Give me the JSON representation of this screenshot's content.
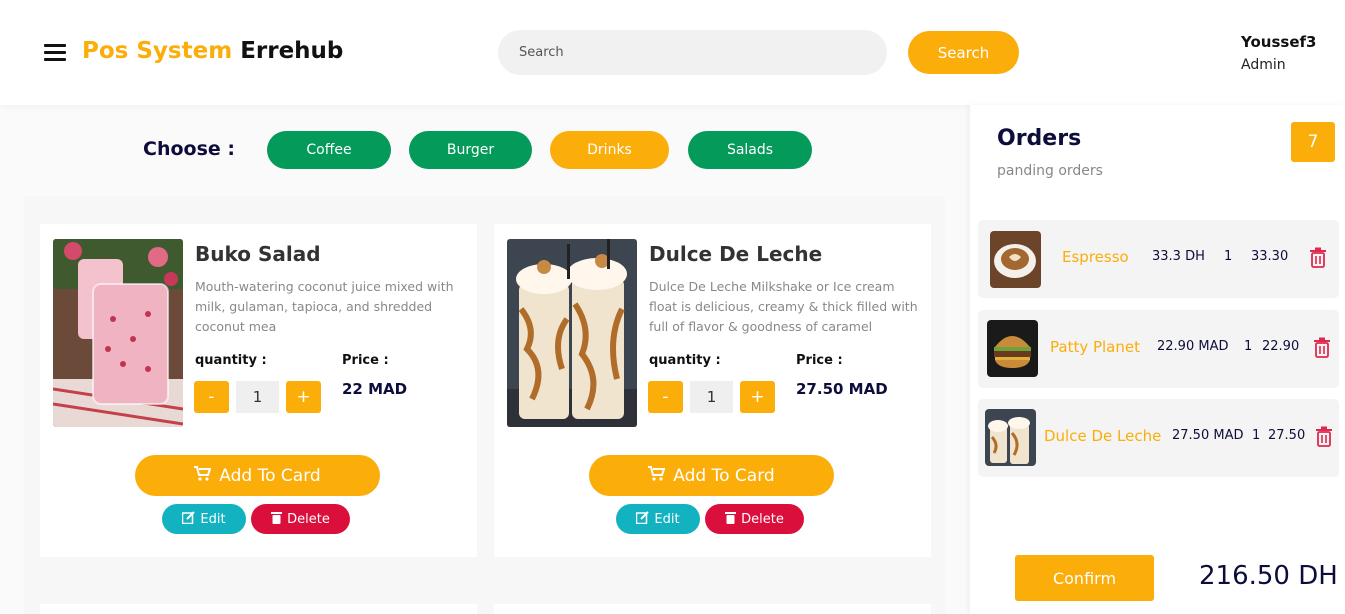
{
  "header": {
    "brand_part1": "Pos System",
    "brand_part2": "Errehub",
    "search_placeholder": "Search",
    "search_button": "Search",
    "user_name": "Youssef3",
    "user_role": "Admin"
  },
  "categories": {
    "label": "Choose :",
    "items": [
      "Coffee",
      "Burger",
      "Drinks",
      "Salads"
    ],
    "active": "Drinks"
  },
  "products": [
    {
      "title": "Buko Salad",
      "description": "Mouth-watering coconut juice mixed with milk, gulaman, tapioca, and shredded coconut mea",
      "quantity_label": "quantity :",
      "price_label": "Price :",
      "quantity": "1",
      "price": "22 MAD",
      "minus": "-",
      "plus": "+",
      "add_label": "Add To Card",
      "edit_label": "Edit",
      "delete_label": "Delete"
    },
    {
      "title": "Dulce De Leche",
      "description": "Dulce De Leche Milkshake or Ice cream float is delicious, creamy & thick filled with full of flavor & goodness of caramel",
      "quantity_label": "quantity :",
      "price_label": "Price :",
      "quantity": "1",
      "price": "27.50 MAD",
      "minus": "-",
      "plus": "+",
      "add_label": "Add To Card",
      "edit_label": "Edit",
      "delete_label": "Delete"
    }
  ],
  "orders": {
    "title": "Orders",
    "subtitle": "panding orders",
    "count": "7",
    "items": [
      {
        "name": "Espresso",
        "price": "33.3 DH",
        "qty": "1",
        "total": "33.30"
      },
      {
        "name": "Patty Planet",
        "price": "22.90 MAD",
        "qty": "1",
        "total": "22.90"
      },
      {
        "name": "Dulce De Leche",
        "price": "27.50 MAD",
        "qty": "1",
        "total": "27.50"
      }
    ],
    "confirm_label": "Confirm",
    "grand_total": "216.50 DH"
  },
  "colors": {
    "accent": "#fbad0a",
    "green": "#049a5a",
    "teal": "#13b2c1",
    "danger": "#db0f3c",
    "navy": "#0d0d3b"
  }
}
